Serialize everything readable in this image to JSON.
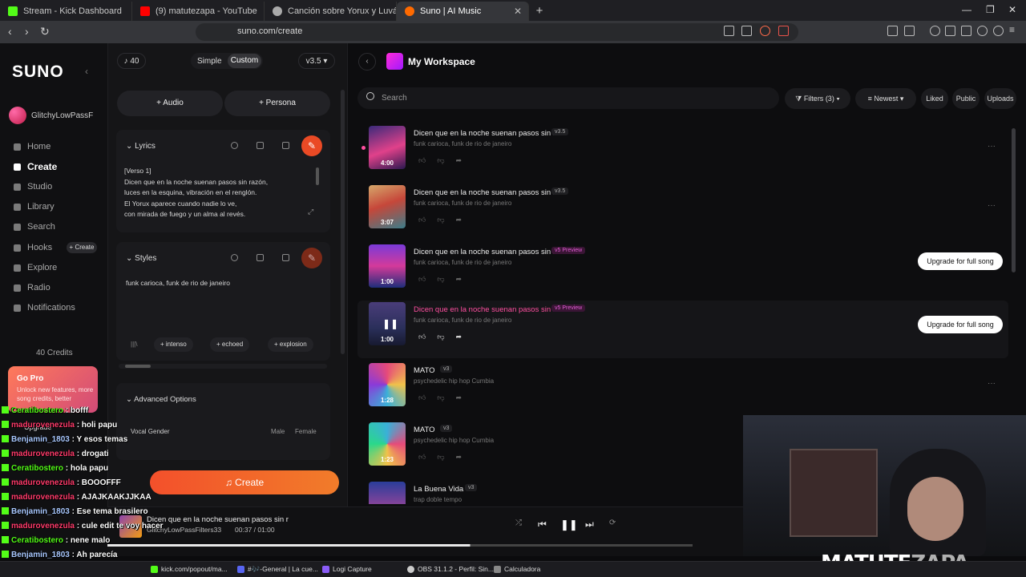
{
  "browser": {
    "tabs": [
      {
        "label": "Stream - Kick Dashboard",
        "color": "#53fc18"
      },
      {
        "label": "(9) matutezapa - YouTube",
        "color": "#ff0000"
      },
      {
        "label": "Canción sobre Yorux y Luvás",
        "color": "#aaaaaa"
      },
      {
        "label": "Suno | AI Music",
        "color": "#ff6a00"
      }
    ],
    "url": "suno.com/create"
  },
  "sidebar": {
    "logo": "SUNO",
    "username": "GlitchyLowPassF",
    "nav": [
      "Home",
      "Create",
      "Studio",
      "Library",
      "Search",
      "Hooks",
      "Explore",
      "Radio",
      "Notifications"
    ],
    "hooks_create": "+ Create",
    "credits": "40 Credits",
    "gopro": {
      "title": "Go Pro",
      "text": "Unlock new features, more song credits, better",
      "button": "Upgrade"
    }
  },
  "create": {
    "notes": "♪ 40",
    "mode_simple": "Simple",
    "mode_custom": "Custom",
    "version": "v3.5 ▾",
    "audio": "+ Audio",
    "persona": "+ Persona",
    "lyrics_title": "Lyrics",
    "lyrics": "[Verso 1]\nDicen que en la noche suenan pasos sin razón,\nluces en la esquina, vibración en el renglón.\nEl Yorux aparece cuando nadie lo ve,\ncon mirada de fuego y un alma al revés.",
    "styles_title": "Styles",
    "styles_text": "funk carioca, funk de rio de janeiro",
    "tags": [
      "+ intenso",
      "+ echoed",
      "+ explosion"
    ],
    "advanced": "Advanced Options",
    "vocal_gender": "Vocal Gender",
    "male": "Male",
    "female": "Female",
    "create_button": "Create"
  },
  "workspace": {
    "title": "My Workspace",
    "search_placeholder": "Search",
    "filters": "Filters (3)",
    "sort": "Newest",
    "liked": "Liked",
    "public": "Public",
    "uploads": "Uploads",
    "songs": [
      {
        "title": "Dicen que en la noche suenan pasos sin r",
        "version": "v3.5",
        "genre": "funk carioca, funk de rio de janeiro",
        "duration": "4:00",
        "upgrade": ""
      },
      {
        "title": "Dicen que en la noche suenan pasos sin r",
        "version": "v3.5",
        "genre": "funk carioca, funk de rio de janeiro",
        "duration": "3:07",
        "upgrade": ""
      },
      {
        "title": "Dicen que en la noche suenan pasos sin r",
        "version": "v5 Preview",
        "genre": "funk carioca, funk de rio de janeiro",
        "duration": "1:00",
        "upgrade": "Upgrade for full song"
      },
      {
        "title": "Dicen que en la noche suenan pasos sin r",
        "version": "v5 Preview",
        "genre": "funk carioca, funk de rio de janeiro",
        "duration": "1:00",
        "upgrade": "Upgrade for full song"
      },
      {
        "title": "MATO",
        "version": "v3",
        "genre": "psychedelic hip hop Cumbia",
        "duration": "1:28",
        "upgrade": ""
      },
      {
        "title": "MATO",
        "version": "v3",
        "genre": "psychedelic hip hop Cumbia",
        "duration": "1:23",
        "upgrade": ""
      },
      {
        "title": "La Buena Vida",
        "version": "v3",
        "genre": "trap doble tempo",
        "duration": "",
        "upgrade": ""
      }
    ]
  },
  "player": {
    "title": "Dicen que en la noche suenan pasos sin r",
    "artist": "GlitchyLowPassFilters33",
    "time": "00:37 / 01:00",
    "progress": 0.62
  },
  "chat": [
    {
      "user": "Ceratibostero",
      "msg": ": bofff",
      "color": "#53fc18"
    },
    {
      "user": "madurovenezula",
      "msg": ": holi papu",
      "color": "#ff3b6b"
    },
    {
      "user": "Benjamin_1803",
      "msg": ": Y esos temas",
      "color": "#a9c8ff"
    },
    {
      "user": "madurovenezula",
      "msg": ": drogati",
      "color": "#ff3b6b"
    },
    {
      "user": "Ceratibostero",
      "msg": ": hola papu",
      "color": "#53fc18"
    },
    {
      "user": "madurovenezula",
      "msg": ": BOOOFFF",
      "color": "#ff3b6b"
    },
    {
      "user": "madurovenezula",
      "msg": ": AJAJKAAKJJKAA",
      "color": "#ff3b6b"
    },
    {
      "user": "Benjamin_1803",
      "msg": ": Ese tema brasilero",
      "color": "#a9c8ff"
    },
    {
      "user": "madurovenezula",
      "msg": ": cule edit te voy hacer",
      "color": "#ff3b6b"
    },
    {
      "user": "Ceratibostero",
      "msg": ": nene malo",
      "color": "#53fc18"
    },
    {
      "user": "Benjamin_1803",
      "msg": ": Ah parecía",
      "color": "#a9c8ff"
    }
  ],
  "streamer": {
    "name_a": "MATUTE",
    "name_b": "ZAPA"
  },
  "taskbar": [
    {
      "label": "kick.com/popout/ma...",
      "color": "#53fc18"
    },
    {
      "label": "#🎶-General | La cue...",
      "color": "#5865f2"
    },
    {
      "label": "Logi Capture",
      "color": "#8a5cf6"
    },
    {
      "label": "OBS 31.1.2 - Perfil: Sin...",
      "color": "#cccccc"
    },
    {
      "label": "Calculadora",
      "color": "#888888"
    }
  ]
}
